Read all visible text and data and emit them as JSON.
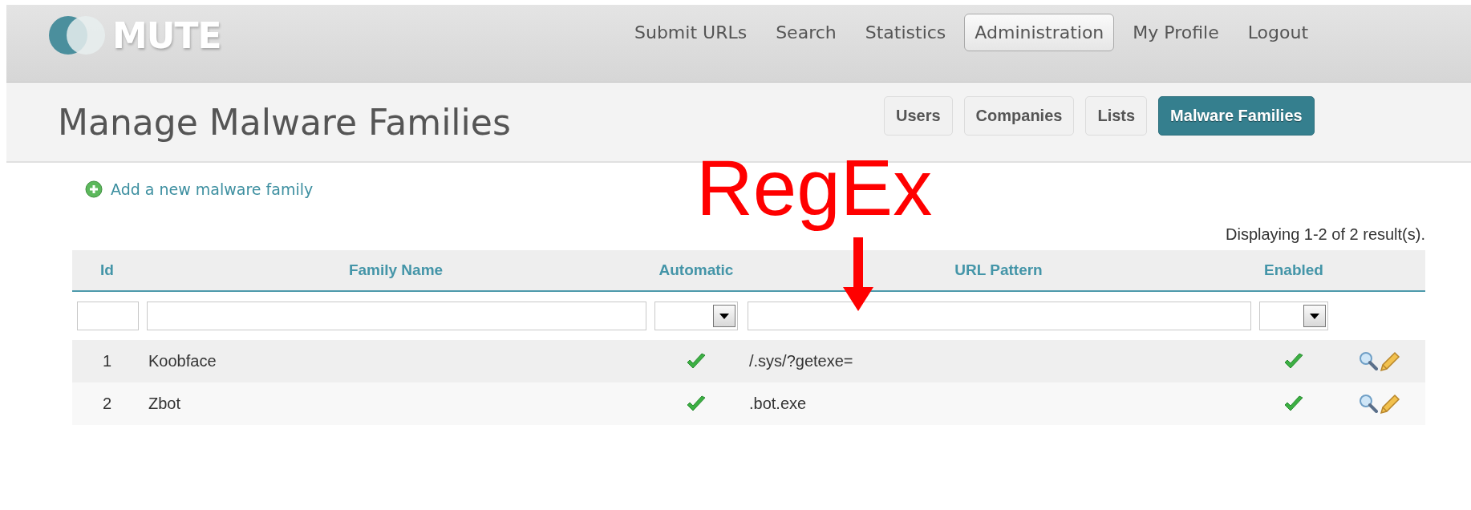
{
  "logo": {
    "text": "MUTE"
  },
  "nav": [
    {
      "label": "Submit URLs",
      "selected": false
    },
    {
      "label": "Search",
      "selected": false
    },
    {
      "label": "Statistics",
      "selected": false
    },
    {
      "label": "Administration",
      "selected": true
    },
    {
      "label": "My Profile",
      "selected": false
    },
    {
      "label": "Logout",
      "selected": false
    }
  ],
  "page_title": "Manage Malware Families",
  "tabs": [
    {
      "label": "Users",
      "selected": false
    },
    {
      "label": "Companies",
      "selected": false
    },
    {
      "label": "Lists",
      "selected": false
    },
    {
      "label": "Malware Families",
      "selected": true
    }
  ],
  "add_link": "Add a new malware family",
  "summary": "Displaying 1-2 of 2 result(s).",
  "table": {
    "columns": [
      "Id",
      "Family Name",
      "Automatic",
      "URL Pattern",
      "Enabled"
    ],
    "filters": [
      {
        "kind": "text"
      },
      {
        "kind": "text"
      },
      {
        "kind": "select"
      },
      {
        "kind": "text"
      },
      {
        "kind": "select"
      }
    ],
    "rows": [
      {
        "id": "1",
        "family_name": "Koobface",
        "automatic": true,
        "url_pattern": "/.sys/?getexe=",
        "enabled": true
      },
      {
        "id": "2",
        "family_name": "Zbot",
        "automatic": true,
        "url_pattern": ".bot.exe",
        "enabled": true
      }
    ]
  },
  "annotation": {
    "text": "RegEx"
  }
}
